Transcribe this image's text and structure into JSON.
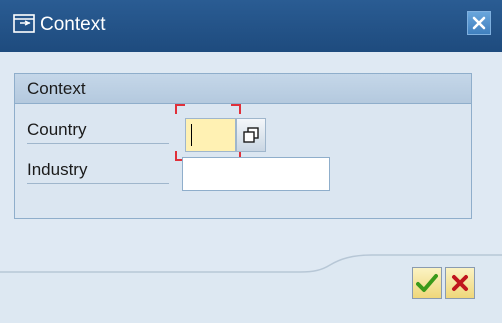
{
  "window": {
    "title": "Context",
    "title_icon": "context-window-icon",
    "close_icon": "close-icon"
  },
  "group": {
    "title": "Context"
  },
  "fields": {
    "country": {
      "label": "Country",
      "value": ""
    },
    "industry": {
      "label": "Industry",
      "value": ""
    }
  },
  "buttons": {
    "ok_icon": "checkmark-icon",
    "cancel_icon": "cancel-x-icon"
  },
  "colors": {
    "title_bar": "#1e4b7e",
    "focused_input_bg": "#fff1b3",
    "ok_check": "#3a9a1a",
    "cancel_x": "#c0161e"
  }
}
